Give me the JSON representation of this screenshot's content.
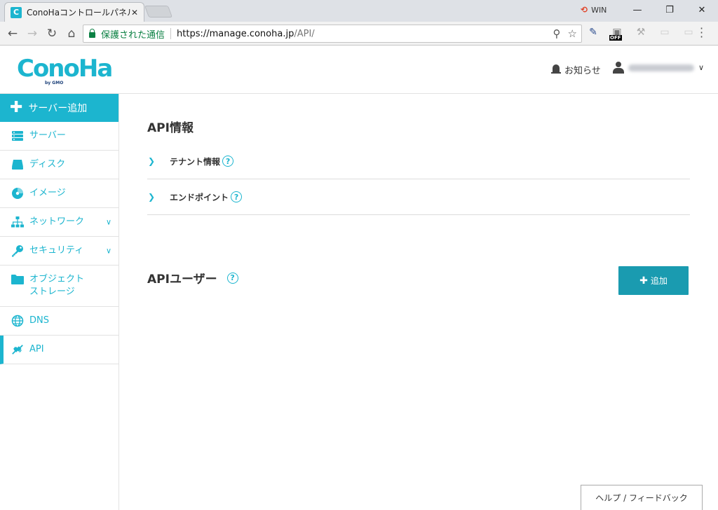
{
  "browser": {
    "tab_favicon": "C",
    "tab_title": "ConoHaコントロールパネル",
    "tab_close": "✕",
    "win_label": "WIN",
    "win_buttons": [
      "—",
      "❐",
      "✕"
    ],
    "secure_text": "保護された通信",
    "url_host": "https://manage.conoha.jp",
    "url_path": "/API/",
    "ext_off_badge": "OFF"
  },
  "header": {
    "logo_text": "ConoHa",
    "logo_sub": "by GMO",
    "notice_label": "お知らせ"
  },
  "sidebar": {
    "add_server": "サーバー追加",
    "items": [
      {
        "label": "サーバー",
        "icon": "server-icon"
      },
      {
        "label": "ディスク",
        "icon": "disk-icon"
      },
      {
        "label": "イメージ",
        "icon": "image-icon"
      },
      {
        "label": "ネットワーク",
        "icon": "network-icon"
      },
      {
        "label": "セキュリティ",
        "icon": "key-icon"
      },
      {
        "label": "オブジェクト\nストレージ",
        "icon": "folder-icon"
      },
      {
        "label": "DNS",
        "icon": "globe-icon"
      },
      {
        "label": "API",
        "icon": "api-icon"
      }
    ]
  },
  "main": {
    "api_info_title": "API情報",
    "rows": [
      {
        "label": "テナント情報"
      },
      {
        "label": "エンドポイント"
      }
    ],
    "api_user_title": "APIユーザー",
    "add_button": "追加",
    "help_feedback": "ヘルプ / フィードバック"
  },
  "colors": {
    "accent": "#1cb5cf",
    "button": "#1a9bb0"
  }
}
